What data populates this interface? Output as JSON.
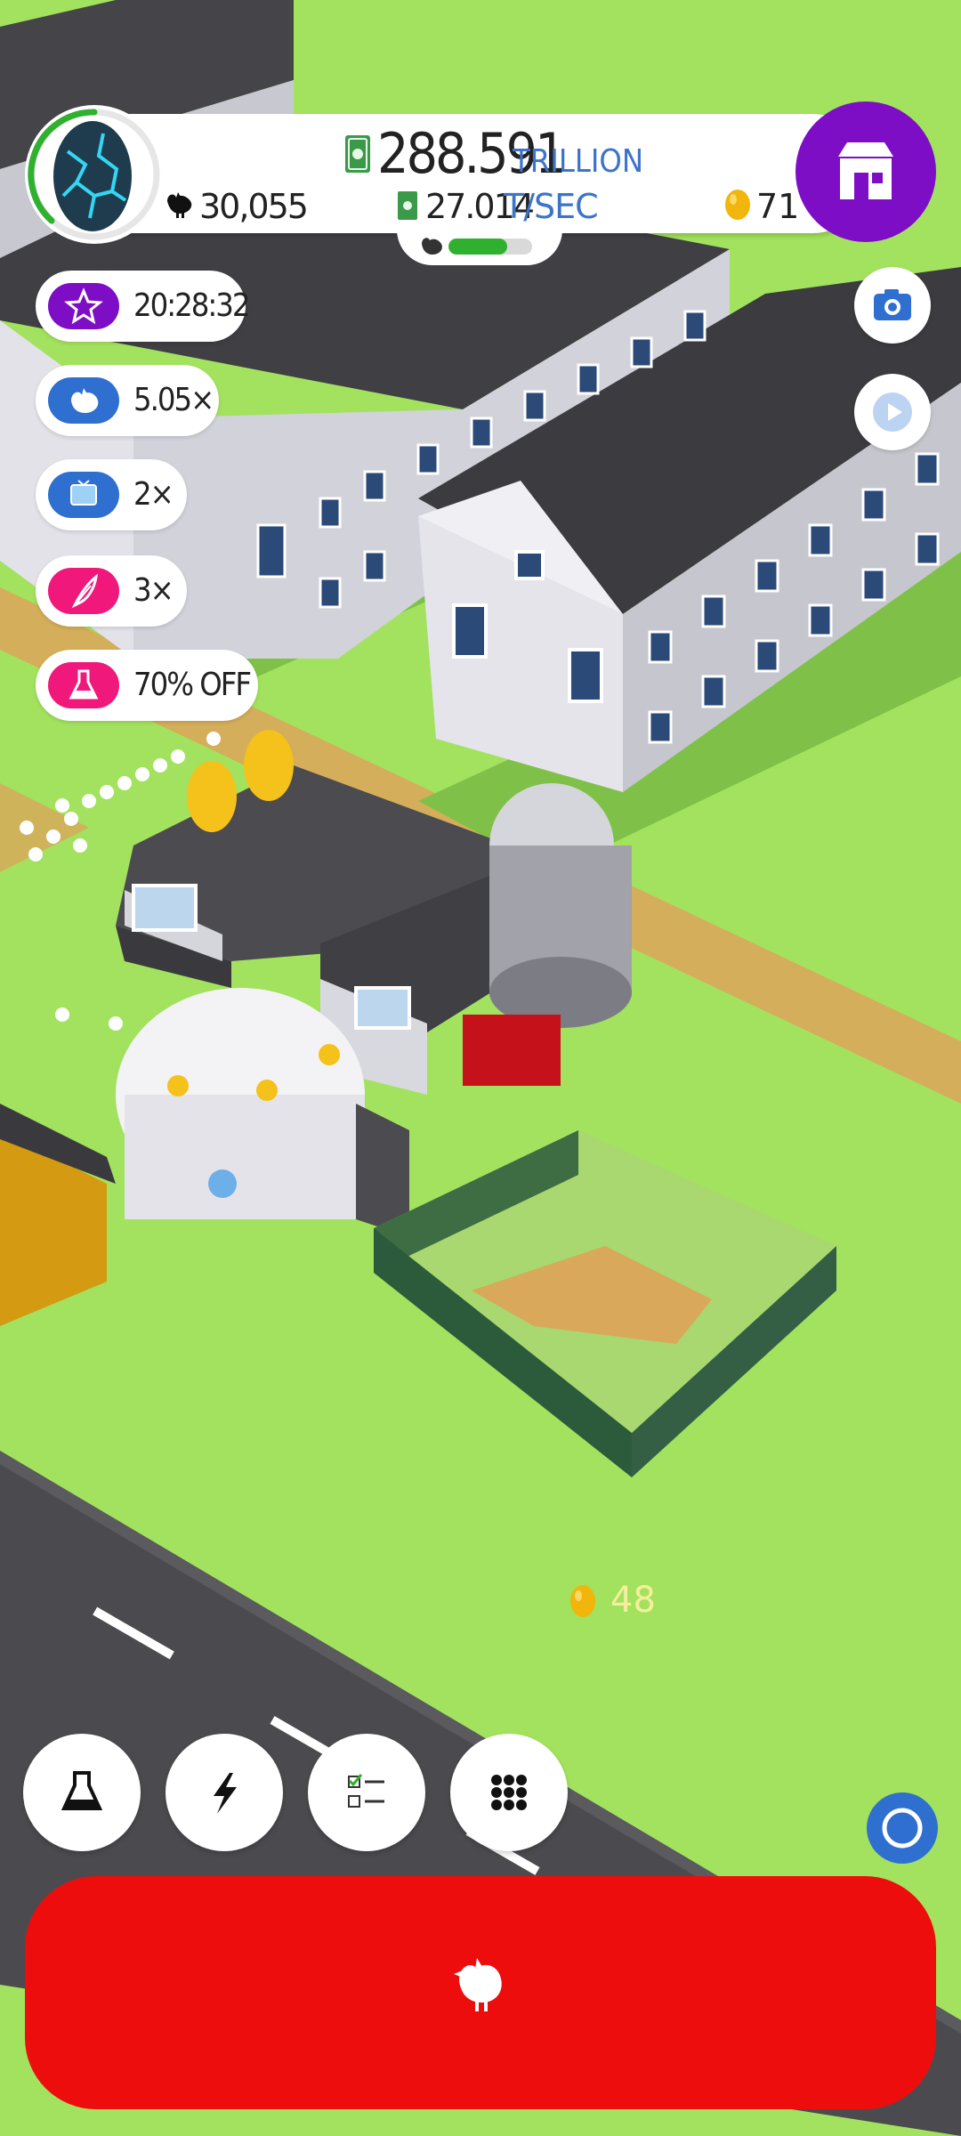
{
  "header": {
    "cash_value": "288.591",
    "cash_unit": "TRILLION",
    "rate_value": "27.014",
    "rate_unit": "T/SEC",
    "chicken_count": "30,055",
    "golden_eggs": "71",
    "hatchery_fill": 0.7
  },
  "boosts": [
    {
      "label": "20:28:32",
      "icon": "star-icon",
      "color": "#7d0ec6"
    },
    {
      "label": "5.05×",
      "icon": "chicken-icon",
      "color": "#2f6fd0"
    },
    {
      "label": "2×",
      "icon": "tv-icon",
      "color": "#2f6fd0"
    },
    {
      "label": "3×",
      "icon": "feather-icon",
      "color": "#f0187a"
    },
    {
      "label": "70% OFF",
      "icon": "flask-icon",
      "color": "#f0187a"
    }
  ],
  "ground": {
    "egg_drop_count": "48"
  },
  "colors": {
    "grass": "#a3e25e",
    "shop": "#7d0ec6",
    "hatch_button": "#ee0d0d",
    "accent_blue": "#3d74c9"
  }
}
